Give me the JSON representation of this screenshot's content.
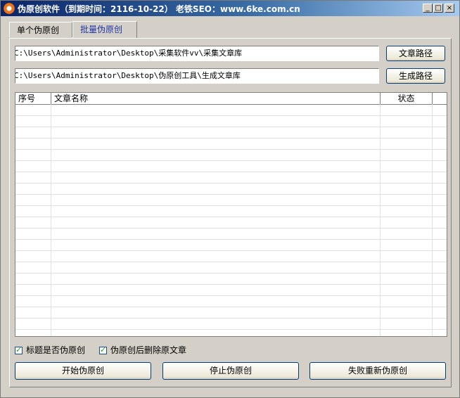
{
  "titlebar": {
    "title": "伪原创软件（到期时间：2116-10-22）  老铁SEO：www.6ke.com.cn",
    "minimize": "_",
    "maximize": "□",
    "close": "×"
  },
  "tabs": [
    "单个伪原创",
    "批量伪原创"
  ],
  "paths": {
    "article_path_value": "C:\\Users\\Administrator\\Desktop\\采集软件vv\\采集文章库",
    "article_path_button": "文章路径",
    "output_path_value": "C:\\Users\\Administrator\\Desktop\\伪原创工具\\生成文章库",
    "output_path_button": "生成路径"
  },
  "table": {
    "columns": [
      "序号",
      "文章名称",
      "状态"
    ],
    "rows": []
  },
  "options": {
    "title_pseudo_label": "标题是否伪原创",
    "title_pseudo_checked": true,
    "delete_after_label": "伪原创后删除原文章",
    "delete_after_checked": true
  },
  "actions": {
    "start": "开始伪原创",
    "stop": "停止伪原创",
    "retry_failed": "失败重新伪原创"
  },
  "colors": {
    "title_bar_start": "#0a246a",
    "title_bar_end": "#a6caf0",
    "active_tab_text": "#1f35a8",
    "window_bg": "#d4d0c8"
  }
}
